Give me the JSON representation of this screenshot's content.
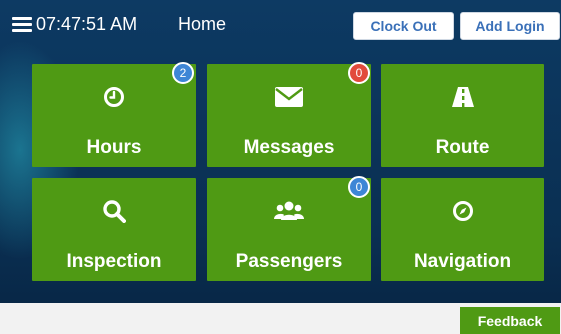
{
  "header": {
    "time": "07:47:51 AM",
    "title": "Home",
    "clock_out_label": "Clock Out",
    "add_login_label": "Add Login"
  },
  "tiles": [
    {
      "label": "Hours",
      "icon": "clock-icon",
      "badge": "2",
      "badge_color": "#3e86d6"
    },
    {
      "label": "Messages",
      "icon": "envelope-icon",
      "badge": "0",
      "badge_color": "#e24b3c"
    },
    {
      "label": "Route",
      "icon": "road-icon"
    },
    {
      "label": "Inspection",
      "icon": "search-icon"
    },
    {
      "label": "Passengers",
      "icon": "users-icon",
      "badge": "0",
      "badge_color": "#3e86d6"
    },
    {
      "label": "Navigation",
      "icon": "compass-icon"
    }
  ],
  "footer": {
    "feedback_label": "Feedback"
  },
  "colors": {
    "tile_green": "#4f9a14",
    "header_button_text": "#3a70b8",
    "background": "#0d3a63"
  }
}
